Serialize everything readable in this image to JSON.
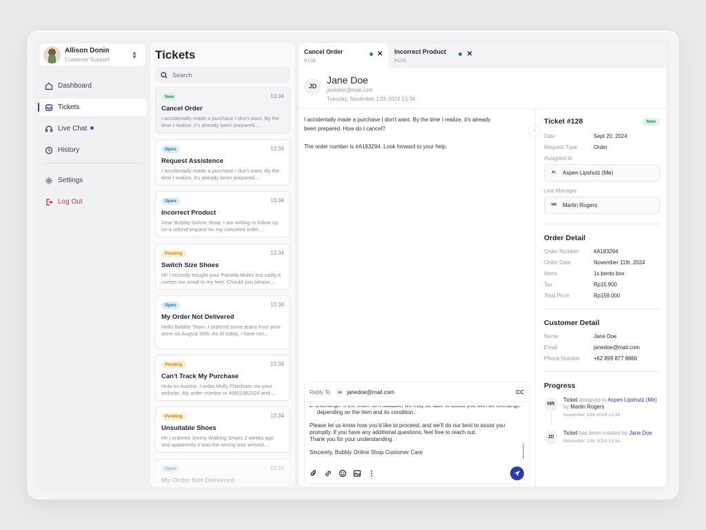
{
  "user": {
    "name": "Allison Donin",
    "role": "Customer Support"
  },
  "nav": {
    "dashboard": "Dashboard",
    "tickets": "Tickets",
    "live_chat": "Live Chat",
    "history": "History",
    "settings": "Settings",
    "logout": "Log Out"
  },
  "tickets": {
    "title": "Tickets",
    "search_placeholder": "Search",
    "items": [
      {
        "status": "New",
        "time": "13:34",
        "title": "Cancel Order",
        "snippet": "I accidentally made a purchase I don't want. By the time I realize, it's already been prepared...."
      },
      {
        "status": "Open",
        "time": "13:34",
        "title": "Request Assistence",
        "snippet": "I accidentally made a purchase I don't want. By the time I realize, it's already been prepared...."
      },
      {
        "status": "Open",
        "time": "13:34",
        "title": "Incorrect Product",
        "snippet": "Dear Bubbly Online Shop, I am writing to follow up on a refund request for my canceled order...."
      },
      {
        "status": "Pending",
        "time": "13:34",
        "title": "Switch Size Shoes",
        "snippet": "Hi! I recently bought your Pamela Mules but sadly it comes too small to my feet. Chould you please...."
      },
      {
        "status": "Open",
        "time": "13:34",
        "title": "My Order Not Delivered",
        "snippet": "Hello Bubbly Team. I ordered some jeans from your store on August 30th. As of today, I have not..."
      },
      {
        "status": "Pending",
        "time": "13:34",
        "title": "Can't Track My Purchase",
        "snippet": "Hola es buomo. I order Molly Flatshoes via your website. My order number is #IB02392024 and...."
      },
      {
        "status": "Pending",
        "time": "13:34",
        "title": "Unsuitable Shoes",
        "snippet": "Hi! I ordered Jimmy Walking Shoes 2 weeks ago and apparently it was the wrong size arrived...."
      },
      {
        "status": "Open",
        "time": "13:34",
        "title": "My Order Not Delivered",
        "snippet": ""
      }
    ]
  },
  "tabs": [
    {
      "title": "Cancel Order",
      "sub": "#128"
    },
    {
      "title": "Incorrect Product",
      "sub": "#128"
    }
  ],
  "conversation": {
    "initials": "JD",
    "name": "Jane Doe",
    "email": "janedoe@mail.com",
    "date": "Tuesday, November 12th 2024 13:34",
    "message_1": "I accidentally made a purchase I don't want. By the time I realize, it's already been prepared. How do I cancel?",
    "message_2": "The order number is #A183294. Look forward to your help."
  },
  "reply": {
    "reply_to_label": "Reply To",
    "to_initials": "JD",
    "to_email": "janedoe@mail.com",
    "cc_label": "CC",
    "line_1": "2. Exchange: If the order isn't suitable, we may be able to assist you with an exchange depending on the item and its condition.",
    "line_2": "Please let us know how you'd like to proceed, and we'll do our best to assist you promptly. If you have any additional questions, feel free to reach out.",
    "line_3": "Thank you for your understanding.",
    "line_4": "Sincerely, Bubbly Online Shop Customer Care"
  },
  "ticket": {
    "title": "Ticket #128",
    "badge": "New",
    "date_label": "Date",
    "date": "Sept 20, 2024",
    "type_label": "Request Type",
    "type": "Order",
    "assigned_label": "Assigned to",
    "assigned_initials": "AL",
    "assigned_name": "Aspen Lipshutz (Me)",
    "manager_label": "Line Manager",
    "manager_initials": "MR",
    "manager_name": "Martin Rogers"
  },
  "order": {
    "title": "Order Detail",
    "number_label": "Order Number",
    "number": "#A183294",
    "date_label": "Order Date",
    "date": "November 11th, 2024",
    "items_label": "Items",
    "items": "1x bento box",
    "tax_label": "Tax",
    "tax": "Rp15.900",
    "total_label": "Total Price",
    "total": "Rp159.000"
  },
  "customer": {
    "title": "Customer Detail",
    "name_label": "Name",
    "name": "Jane Doe",
    "email_label": "Email",
    "email": "janedoe@mail.com",
    "phone_label": "Phone Number",
    "phone": "+62 899 877 8666"
  },
  "progress": {
    "title": "Progress",
    "item_1": {
      "initials": "MR",
      "subject": "Ticket",
      "action": "assigned to",
      "target": "Aspen Lipshutz (Me)",
      "by": "by",
      "actor": "Martin Rogers",
      "date": "November 12th 2024 13:34"
    },
    "item_2": {
      "initials": "JD",
      "subject": "Ticket",
      "action": "has been created by",
      "actor": "Jane Doe",
      "date": "November 12th 2024 13:34"
    }
  },
  "colors": {
    "accent": "#2b3bb8",
    "new": "#2a8a52",
    "open": "#2a6ea0",
    "pending": "#c0891c",
    "danger": "#c43b3b"
  }
}
